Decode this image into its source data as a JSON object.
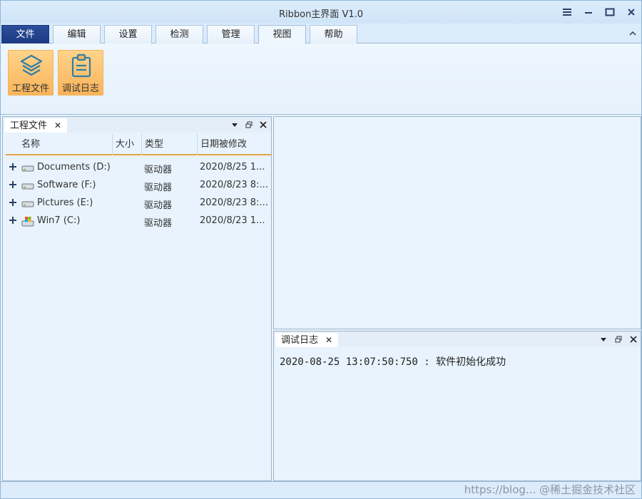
{
  "window": {
    "title": "Ribbon主界面 V1.0"
  },
  "ribbon": {
    "tabs": [
      {
        "label": "文件"
      },
      {
        "label": "编辑"
      },
      {
        "label": "设置"
      },
      {
        "label": "检测"
      },
      {
        "label": "管理"
      },
      {
        "label": "视图"
      },
      {
        "label": "帮助"
      }
    ],
    "active_tab": "视图",
    "buttons": [
      {
        "label": "工程文件",
        "icon": "layers-icon"
      },
      {
        "label": "调试日志",
        "icon": "clipboard-icon"
      }
    ]
  },
  "project_panel": {
    "title": "工程文件",
    "columns": [
      "名称",
      "大小",
      "类型",
      "日期被修改"
    ],
    "rows": [
      {
        "name": "Documents (D:)",
        "type": "驱动器",
        "modified": "2020/8/25 1...",
        "icon": "drive-icon"
      },
      {
        "name": "Software (F:)",
        "type": "驱动器",
        "modified": "2020/8/23 8:...",
        "icon": "drive-icon"
      },
      {
        "name": "Pictures (E:)",
        "type": "驱动器",
        "modified": "2020/8/23 8:...",
        "icon": "drive-icon"
      },
      {
        "name": "Win7 (C:)",
        "type": "驱动器",
        "modified": "2020/8/23 1...",
        "icon": "system-drive-icon"
      }
    ]
  },
  "log_panel": {
    "title": "调试日志",
    "lines": [
      "2020-08-25 13:07:50:750 : 软件初始化成功"
    ]
  },
  "status": {
    "watermark": "https://blog... @稀土掘金技术社区"
  },
  "colors": {
    "file_tab": "#1c3a85",
    "ribbon_button": "#f9b45a",
    "column_underline": "#e8a24a",
    "background": "#e9f3fc"
  }
}
